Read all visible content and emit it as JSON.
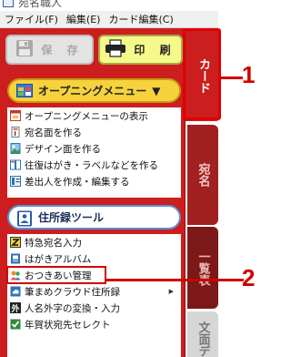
{
  "window": {
    "title": "宛名職人"
  },
  "menubar": {
    "items": [
      "ファイル(F)",
      "編集(E)",
      "カード編集(C)"
    ]
  },
  "toolbar": {
    "save_label": "保 存",
    "print_label": "印 刷"
  },
  "opening_menu": {
    "header_label": "オープニングメニュー",
    "items": [
      {
        "label": "オープニングメニューの表示",
        "icon": "window-icon"
      },
      {
        "label": "宛名面を作る",
        "icon": "postcard-icon"
      },
      {
        "label": "デザイン面を作る",
        "icon": "picture-icon"
      },
      {
        "label": "往復はがき・ラベルなどを作る",
        "icon": "return-postcard-icon"
      },
      {
        "label": "差出人を作成・編集する",
        "icon": "sender-card-icon"
      }
    ]
  },
  "address_tools": {
    "header_label": "住所録ツール",
    "items": [
      {
        "label": "特急宛名入力",
        "icon": "express-input-icon"
      },
      {
        "label": "はがきアルバム",
        "icon": "album-icon"
      },
      {
        "label": "おつきあい管理",
        "icon": "relationship-icon",
        "highlighted": true
      },
      {
        "label": "筆まめクラウド住所録",
        "icon": "cloud-address-icon",
        "has_submenu": true
      },
      {
        "label": "人名外字の変換・入力",
        "icon": "gaiji-icon",
        "icon_text": "外"
      },
      {
        "label": "年賀状宛先セレクト",
        "icon": "checkbox-icon"
      }
    ]
  },
  "side_tabs": {
    "card": "カード",
    "address": "宛名",
    "list": "一覧表",
    "text": "文面デ"
  },
  "callouts": [
    "1",
    "2"
  ],
  "colors": {
    "panel_red": "#cc1e1e",
    "highlight_red": "#e00000",
    "print_yellow": "#f4f98a",
    "opening_yellow": "#f6d23c",
    "address_blue": "#5d8fd8"
  }
}
